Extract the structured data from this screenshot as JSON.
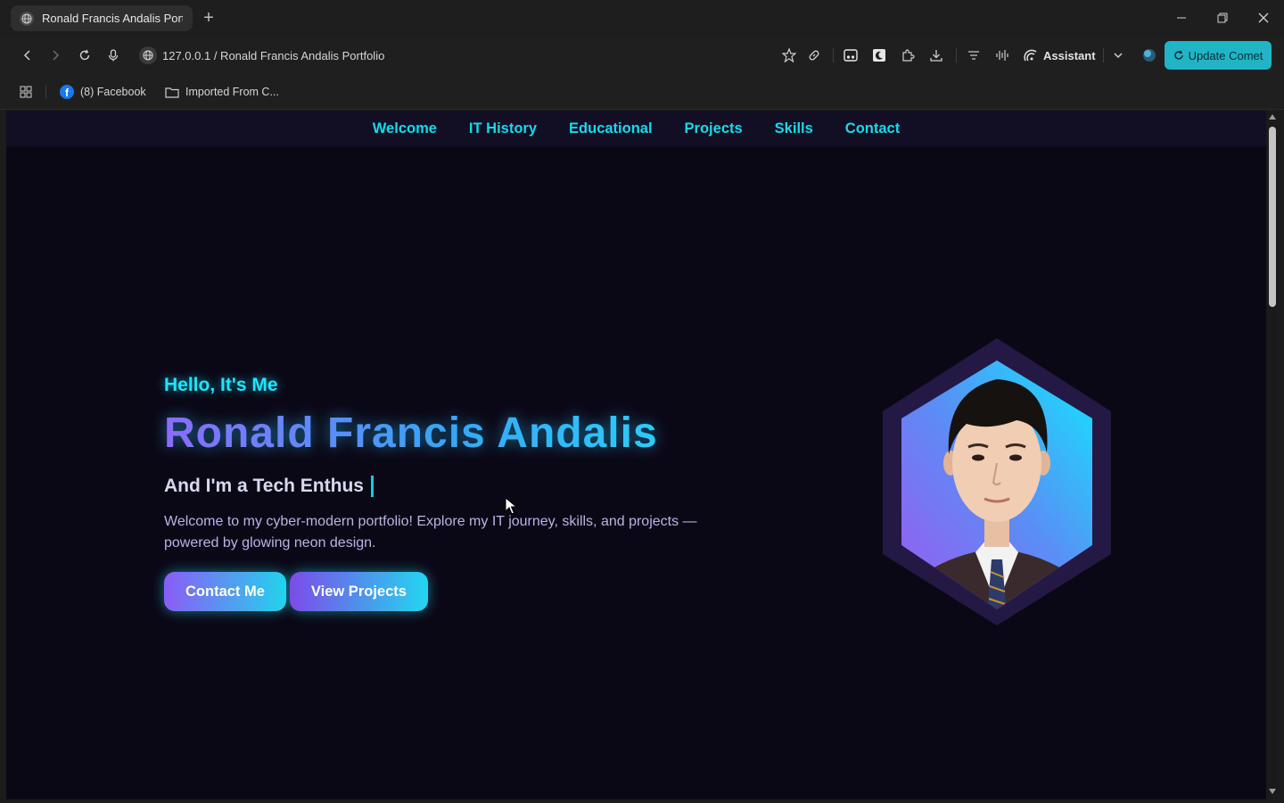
{
  "browser": {
    "tab_title": "Ronald Francis Andalis Portfol",
    "url_text": "127.0.0.1 / Ronald Francis Andalis Portfolio",
    "assistant_label": "Assistant",
    "update_label": "Update Comet",
    "update_color": "#1fb5c6"
  },
  "bookmarks": [
    {
      "label": "(8) Facebook",
      "icon": "facebook-icon"
    },
    {
      "label": "Imported From C...",
      "icon": "folder-icon"
    }
  ],
  "nav": {
    "items": [
      "Welcome",
      "IT History",
      "Educational",
      "Projects",
      "Skills",
      "Contact"
    ],
    "color": "#18d8ec"
  },
  "hero": {
    "greeting": "Hello, It's Me",
    "name": "Ronald Francis Andalis",
    "subtitle": "And I'm a Tech Enthus",
    "description": "Welcome to my cyber-modern portfolio! Explore my IT journey, skills, and projects —powered by glowing neon design.",
    "contact_button": "Contact Me",
    "projects_button": "View Projects"
  },
  "theme": {
    "background": "#0b0816",
    "neon_cyan": "#22e4ff",
    "neon_purple": "#8b5cf6"
  }
}
